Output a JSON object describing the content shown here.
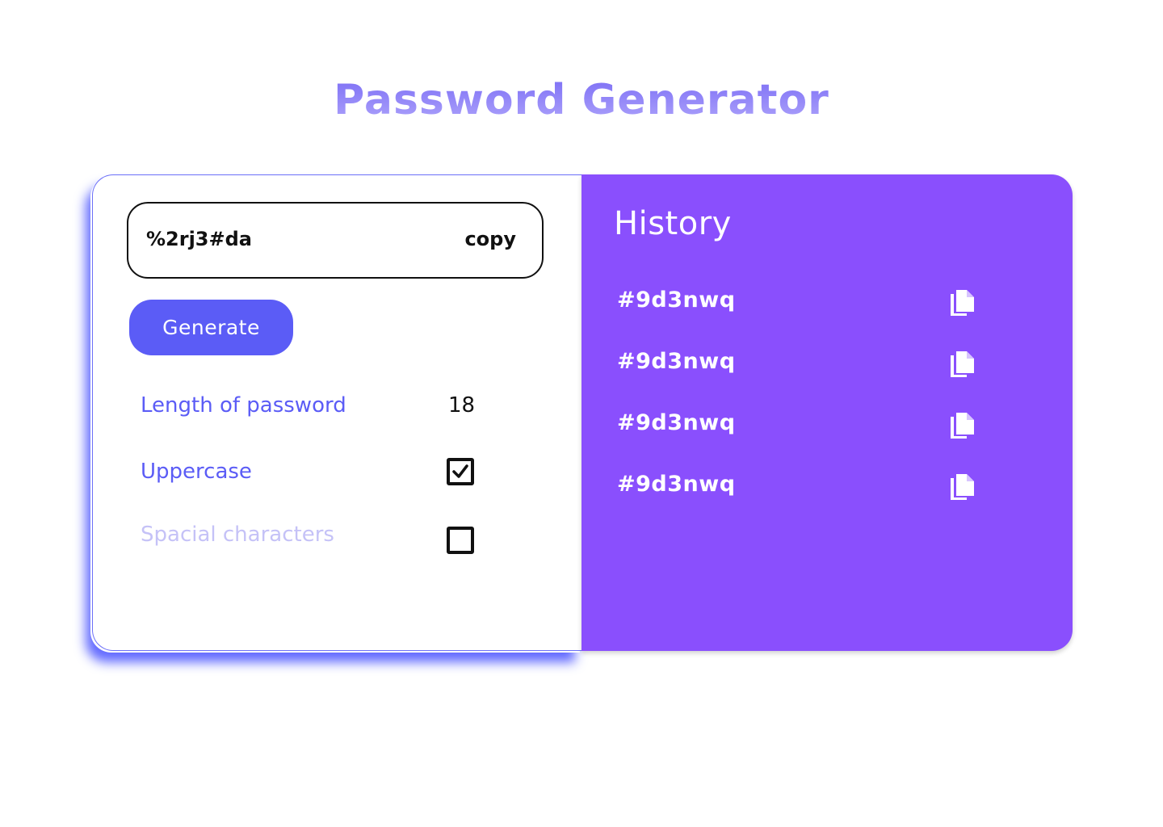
{
  "page": {
    "title": "Password Generator"
  },
  "generator": {
    "password_value": "%2rj3#da",
    "copy_label": "copy",
    "generate_label": "Generate",
    "length_label": "Length of password",
    "length_value": "18",
    "uppercase_label": "Uppercase",
    "uppercase_checked": true,
    "special_label": "Spacial characters",
    "special_checked": false
  },
  "history": {
    "title": "History",
    "items": [
      {
        "value": "#9d3nwq",
        "icon": "copy-icon"
      },
      {
        "value": "#9d3nwq",
        "icon": "copy-icon"
      },
      {
        "value": "#9d3nwq",
        "icon": "copy-icon"
      },
      {
        "value": "#9d3nwq",
        "icon": "copy-icon"
      }
    ]
  },
  "colors": {
    "accent": "#5b5cf6",
    "history_bg": "#8a4ffd",
    "dim_label": "#c5c2f7",
    "title_gradient_top": "#7a6cf5",
    "title_gradient_bottom": "#b0a6fb"
  }
}
